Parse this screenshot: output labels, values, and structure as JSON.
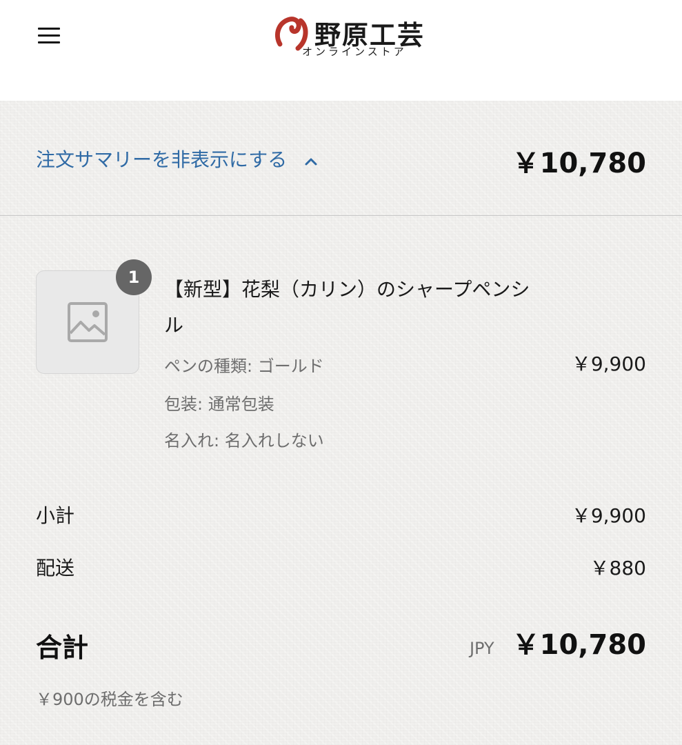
{
  "header": {
    "logo_title": "野原工芸",
    "logo_subtitle": "オンラインストア",
    "brand_mark_color": "#b8352b"
  },
  "summary_toggle": {
    "label": "注文サマリーを非表示にする",
    "total": "￥10,780"
  },
  "line_item": {
    "quantity": "1",
    "title": "【新型】花梨（カリン）のシャープペンシル",
    "options": [
      "ペンの種類: ゴールド",
      "包装: 通常包装",
      "名入れ: 名入れしない"
    ],
    "price": "￥9,900"
  },
  "totals": {
    "subtotal_label": "小計",
    "subtotal_value": "￥9,900",
    "shipping_label": "配送",
    "shipping_value": "￥880",
    "total_label": "合計",
    "currency": "JPY",
    "total_value": "￥10,780",
    "tax_note": "￥900の税金を含む"
  },
  "colors": {
    "link": "#2f6aa5",
    "summary_bg": "#f1f0ee"
  },
  "icons": {
    "menu": "hamburger-menu-icon",
    "toggle": "chevron-up-icon",
    "thumbnail": "image-placeholder-icon"
  }
}
